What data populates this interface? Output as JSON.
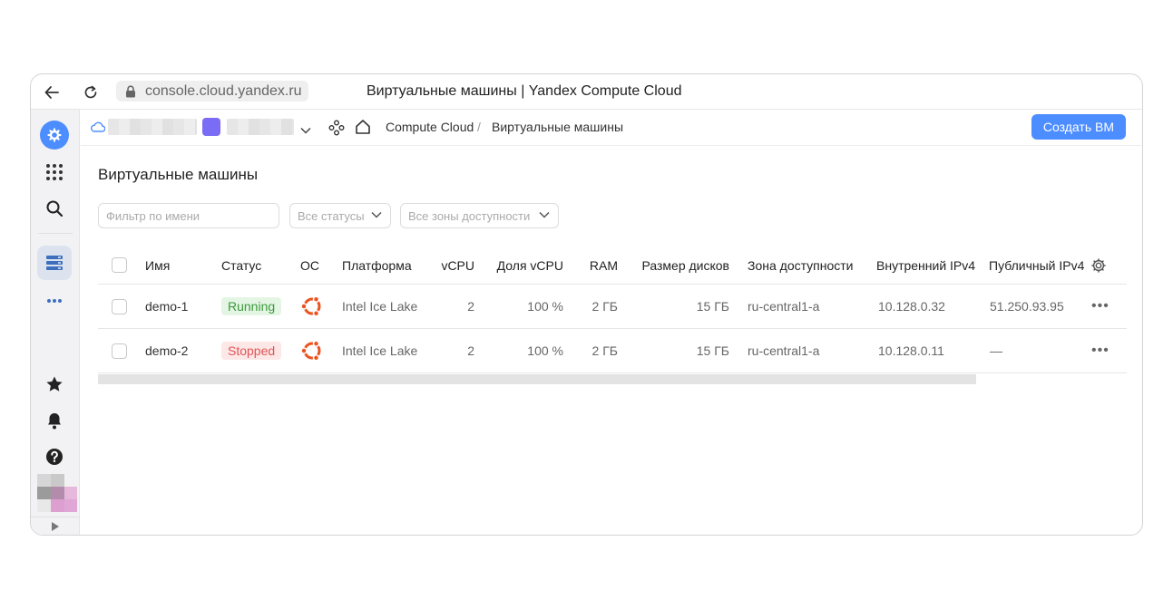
{
  "browser": {
    "url": "console.cloud.yandex.ru",
    "tab_title": "Виртуальные машины | Yandex Compute Cloud"
  },
  "breadcrumb": {
    "service": "Compute Cloud",
    "separator": "/",
    "current": "Виртуальные машины"
  },
  "header": {
    "create_button": "Создать ВМ"
  },
  "main": {
    "title": "Виртуальные машины",
    "filters": {
      "name_placeholder": "Фильтр по имени",
      "status_select": "Все статусы",
      "zone_select": "Все зоны доступности"
    }
  },
  "table": {
    "columns": [
      "Имя",
      "Статус",
      "ОС",
      "Платформа",
      "vCPU",
      "Доля vCPU",
      "RAM",
      "Размер дисков",
      "Зона доступности",
      "Внутренний IPv4",
      "Публичный IPv4"
    ],
    "rows": [
      {
        "name": "demo-1",
        "status": "Running",
        "os_icon": "ubuntu-icon",
        "platform": "Intel Ice Lake",
        "vcpu": "2",
        "vcpu_share": "100 %",
        "ram": "2 ГБ",
        "disk": "15 ГБ",
        "zone": "ru-central1-a",
        "internal_ip": "10.128.0.32",
        "public_ip": "51.250.93.95"
      },
      {
        "name": "demo-2",
        "status": "Stopped",
        "os_icon": "ubuntu-icon",
        "platform": "Intel Ice Lake",
        "vcpu": "2",
        "vcpu_share": "100 %",
        "ram": "2 ГБ",
        "disk": "15 ГБ",
        "zone": "ru-central1-a",
        "internal_ip": "10.128.0.11",
        "public_ip": "—"
      }
    ],
    "row_menu_label": "•••"
  },
  "colors": {
    "accent": "#4c8dff",
    "running_bg": "#e4f5e4",
    "running_text": "#3a9a3a",
    "stopped_bg": "#fde7e7",
    "stopped_text": "#e05555",
    "ubuntu": "#e95420",
    "project": "#7b6cf6"
  }
}
